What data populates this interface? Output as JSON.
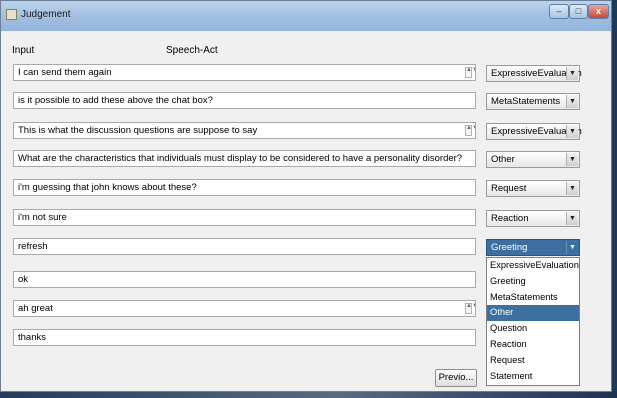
{
  "window": {
    "title": "Judgement"
  },
  "titlebar_buttons": {
    "minimize": "–",
    "maximize": "□",
    "close": "x"
  },
  "headers": {
    "input": "Input",
    "speech_act": "Speech-Act"
  },
  "rows": [
    {
      "text": "I can send them again",
      "act": "ExpressiveEvaluation",
      "spinner": true
    },
    {
      "text": "is it possible to add these above the chat box?",
      "act": "MetaStatements",
      "spinner": false
    },
    {
      "text": "This is what the discussion questions are suppose to say",
      "act": "ExpressiveEvaluation",
      "spinner": true
    },
    {
      "text": "What are the characteristics that individuals must display to be considered to have a personality disorder?",
      "act": "Other",
      "spinner": false
    },
    {
      "text": "i'm guessing that john knows about these?",
      "act": "Request",
      "spinner": false
    },
    {
      "text": "i'm not sure",
      "act": "Reaction",
      "spinner": false
    },
    {
      "text": "refresh",
      "act": "Greeting",
      "spinner": false,
      "open": true
    },
    {
      "text": "ok",
      "act": "",
      "spinner": false
    },
    {
      "text": "ah great",
      "act": "",
      "spinner": true
    },
    {
      "text": "thanks",
      "act": "",
      "spinner": false
    }
  ],
  "dropdown": {
    "options": [
      "ExpressiveEvaluation",
      "Greeting",
      "MetaStatements",
      "Other",
      "Question",
      "Reaction",
      "Request",
      "Statement"
    ],
    "highlighted": "Other"
  },
  "buttons": {
    "previous": "Previo..."
  },
  "icons": {
    "combo_arrow": "▼",
    "spinner": "▲▼"
  }
}
